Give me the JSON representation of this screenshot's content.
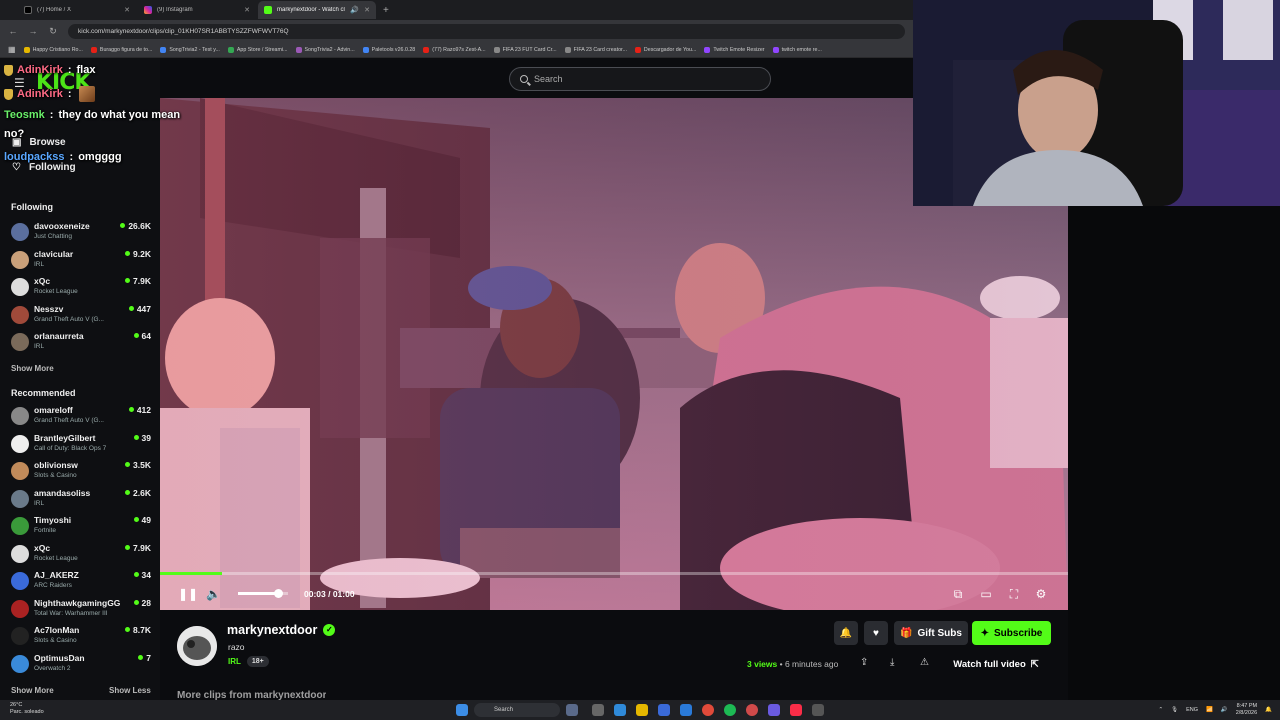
{
  "browser": {
    "tabs": [
      {
        "title": "(7) Home / X",
        "icon": "x-icon",
        "color": "#000000"
      },
      {
        "title": "(9) Instagram",
        "icon": "instagram-icon",
        "color": "#d6249f"
      },
      {
        "title": "markynextdoor - Watch clip",
        "icon": "kick-icon",
        "color": "#53fc18"
      }
    ],
    "url": "kick.com/markynextdoor/clips/clip_01KH07SR1ABBTYSZZFWFWVT76Q",
    "bookmarks": [
      {
        "label": "Happy Cristiano Ro...",
        "color": "#e6b800"
      },
      {
        "label": "Buraggo figura de to...",
        "color": "#e62117"
      },
      {
        "label": "SongTrivia2 - Test y...",
        "color": "#4285f4"
      },
      {
        "label": "App Store / Streami...",
        "color": "#34a853"
      },
      {
        "label": "SongTrivia2 - Advin...",
        "color": "#9b59b6"
      },
      {
        "label": "Paletools v26.0.28",
        "color": "#4285f4"
      },
      {
        "label": "(77) Razo97s Zest-A...",
        "color": "#e62117"
      },
      {
        "label": "FIFA 23 FUT Card Cr...",
        "color": "#888888"
      },
      {
        "label": "FIFA 23 Card creator...",
        "color": "#888888"
      },
      {
        "label": "Descargador de You...",
        "color": "#e62117"
      },
      {
        "label": "Twitch Emote Resizer",
        "color": "#9146ff"
      },
      {
        "label": "twitch emote re...",
        "color": "#9146ff"
      }
    ]
  },
  "kick": {
    "logo": "KICK",
    "search_placeholder": "Search",
    "nav": {
      "browse": "Browse",
      "following": "Following"
    },
    "following_head": "Following",
    "following": [
      {
        "name": "davooxeneize",
        "category": "Just Chatting",
        "viewers": "26.6K",
        "color": "#5b6f9e"
      },
      {
        "name": "clavicular",
        "category": "IRL",
        "viewers": "9.2K",
        "color": "#c9a07a"
      },
      {
        "name": "xQc",
        "category": "Rocket League",
        "viewers": "7.9K",
        "color": "#dddddd"
      },
      {
        "name": "Nesszv",
        "category": "Grand Theft Auto V (G...",
        "viewers": "447",
        "color": "#a04a3a"
      },
      {
        "name": "orlanaurreta",
        "category": "IRL",
        "viewers": "64",
        "color": "#7a6a5a"
      }
    ],
    "show_more": "Show More",
    "recommended_head": "Recommended",
    "recommended": [
      {
        "name": "omareloff",
        "category": "Grand Theft Auto V (G...",
        "viewers": "412",
        "color": "#888888"
      },
      {
        "name": "BrantleyGilbert",
        "category": "Call of Duty: Black Ops 7",
        "viewers": "39",
        "color": "#eeeeee"
      },
      {
        "name": "oblivionsw",
        "category": "Slots & Casino",
        "viewers": "3.5K",
        "color": "#c08a5a"
      },
      {
        "name": "amandasoliss",
        "category": "IRL",
        "viewers": "2.6K",
        "color": "#6a7a8a"
      },
      {
        "name": "Timyoshi",
        "category": "Fortnite",
        "viewers": "49",
        "color": "#3a9a3a"
      },
      {
        "name": "xQc",
        "category": "Rocket League",
        "viewers": "7.9K",
        "color": "#dddddd"
      },
      {
        "name": "AJ_AKERZ",
        "category": "ARC Raiders",
        "viewers": "34",
        "color": "#3a6ad9"
      },
      {
        "name": "NighthawkgamingGG",
        "category": "Total War: Warhammer III",
        "viewers": "28",
        "color": "#aa2222"
      },
      {
        "name": "Ac7lonMan",
        "category": "Slots & Casino",
        "viewers": "8.7K",
        "color": "#222222"
      },
      {
        "name": "OptimusDan",
        "category": "Overwatch 2",
        "viewers": "7",
        "color": "#3a8ad9"
      }
    ],
    "show_less": "Show Less",
    "show_more_bottom": "Show More"
  },
  "chat": [
    {
      "user": "AdinKirk",
      "sep": ":",
      "msg": "flax"
    },
    {
      "user": "AdinKirk",
      "sep": ":",
      "msg": ""
    },
    {
      "user": "Teosmk",
      "sep": ":",
      "msg": "they do what you mean"
    },
    {
      "user": "",
      "sep": "",
      "msg": "no?"
    },
    {
      "user": "loudpackss",
      "sep": ":",
      "msg": "omgggg"
    }
  ],
  "player": {
    "time": "00:03 / 01:00",
    "progress": 0.068,
    "volume": 0.8
  },
  "clip": {
    "streamer": "markynextdoor",
    "title": "razo",
    "category": "IRL",
    "age_tag": "18+",
    "views_count": "3 views",
    "ago": "• 6 minutes ago",
    "gift_subs": "Gift Subs",
    "subscribe": "Subscribe",
    "watch_full": "Watch full video",
    "more_clips": "More clips from markynextdoor"
  },
  "taskbar": {
    "weather_temp": "26°C",
    "weather_desc": "Parc. soleado",
    "search": "Search",
    "lang": "ENG",
    "time": "8:47 PM",
    "date": "2/8/2026"
  },
  "colors": {
    "kick_green": "#53fc18",
    "bg": "#0b0c0f"
  }
}
